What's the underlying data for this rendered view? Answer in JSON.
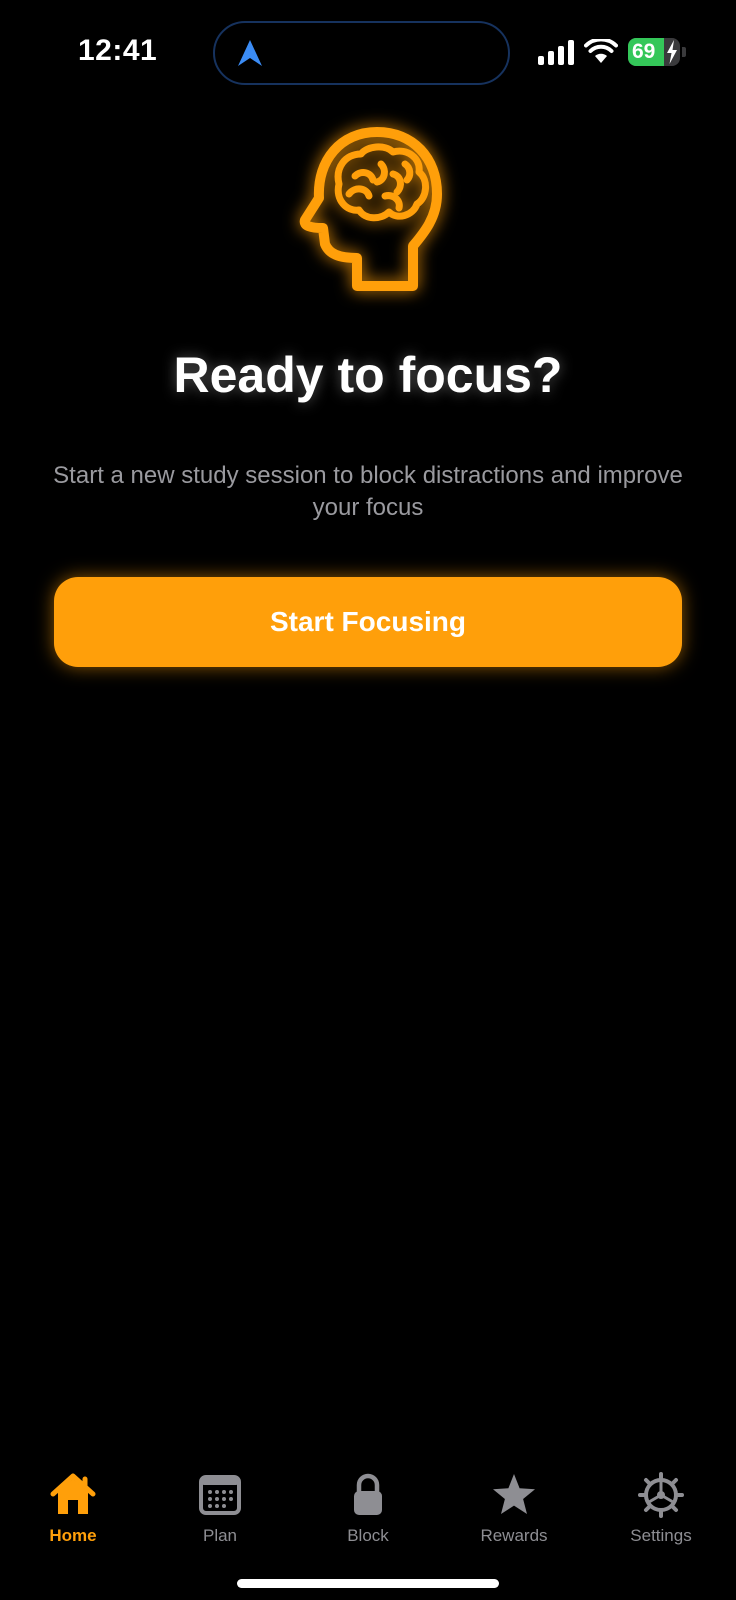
{
  "status_bar": {
    "time": "12:41",
    "battery_level": "69",
    "battery_fraction": 0.69,
    "signal_bars": 4,
    "charging": true
  },
  "hero": {
    "icon": "brain-head-icon",
    "title": "Ready to focus?",
    "subtitle": "Start a new study session to block distractions and improve your focus"
  },
  "cta": {
    "label": "Start Focusing"
  },
  "tabbar": {
    "tabs": [
      {
        "label": "Home",
        "icon": "house-icon",
        "active": true
      },
      {
        "label": "Plan",
        "icon": "calendar-icon",
        "active": false
      },
      {
        "label": "Block",
        "icon": "lock-icon",
        "active": false
      },
      {
        "label": "Rewards",
        "icon": "star-icon",
        "active": false
      },
      {
        "label": "Settings",
        "icon": "gear-icon",
        "active": false
      }
    ]
  },
  "colors": {
    "accent": "#ff9f0a",
    "background": "#000000",
    "inactive": "#8e8e93",
    "subtitle": "#9a9a9f",
    "battery": "#34c759",
    "location": "#3b8cf5"
  }
}
